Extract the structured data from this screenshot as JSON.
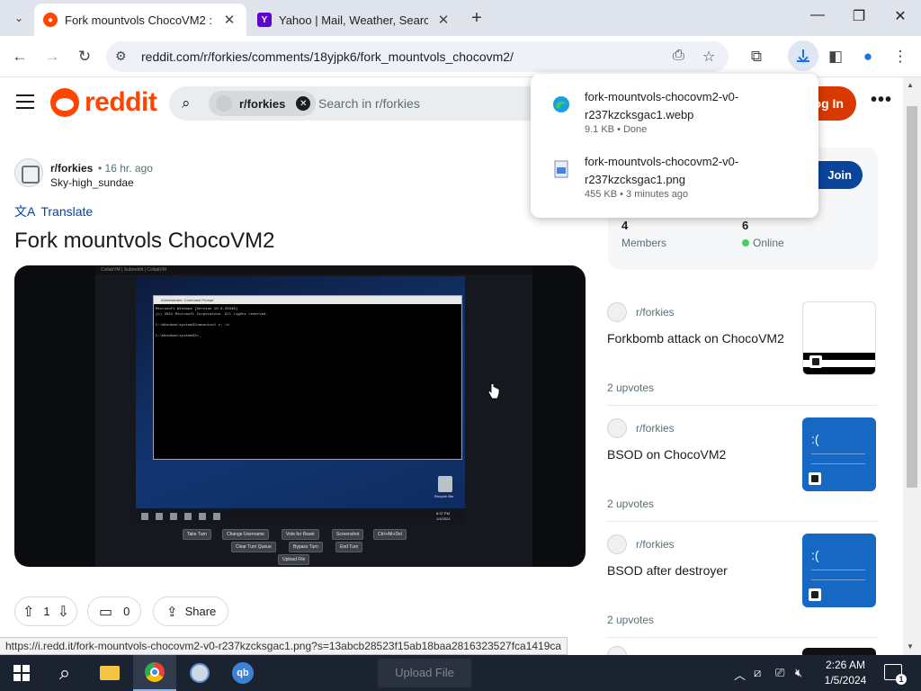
{
  "browser": {
    "tabs": [
      {
        "title": "Fork mountvols ChocoVM2 : r/",
        "active": true
      },
      {
        "title": "Yahoo | Mail, Weather, Search,",
        "active": false
      }
    ],
    "url": "reddit.com/r/forkies/comments/18yjpk6/fork_mountvols_chocovm2/",
    "status_url": "https://i.redd.it/fork-mountvols-chocovm2-v0-r237kzcksgac1.png?s=13abcb28523f15ab18baa2816323527fca1419ca"
  },
  "downloads": [
    {
      "name": "fork-mountvols-chocovm2-v0-r237kzcksgac1.webp",
      "meta": "9.1 KB • Done",
      "icon": "edge-icon"
    },
    {
      "name": "fork-mountvols-chocovm2-v0-r237kzcksgac1.png",
      "meta": "455 KB • 3 minutes ago",
      "icon": "image-file-icon"
    }
  ],
  "reddit": {
    "logo_text": "reddit",
    "search_chip": "r/forkies",
    "search_placeholder": "Search in r/forkies",
    "login_label": "Log In"
  },
  "post": {
    "subreddit": "r/forkies",
    "time": "• 16 hr. ago",
    "author": "Sky-high_sundae",
    "translate": "Translate",
    "title": "Fork mountvols ChocoVM2",
    "upvotes": "1",
    "comments": "0",
    "share_label": "Share"
  },
  "vm": {
    "top_bar": "CollabVM | Subreddit | CollabVM",
    "cmd_title": "Administrator: Command Prompt",
    "cmd_text": "Microsoft Windows [Version 10.0.20348]\n(c) 2021 Microsoft Corporation. All rights reserved.\n\nC:\\Windows\\system32>mountvol c: /d\n\nC:\\Windows\\system32>_",
    "recycle_label": "Recycle Bin",
    "clock": "8:37 PM\n1/4/2024",
    "buttons": [
      "Take Turn",
      "Change Username",
      "Vote for Reset",
      "Screenshot",
      "Ctrl+Alt+Del",
      "Clear Turn Queue",
      "Bypass Turn",
      "End Turn",
      "Upload File"
    ]
  },
  "sidebar": {
    "join_label": "Join",
    "members_count": "4",
    "members_label": "Members",
    "online_count": "6",
    "online_label": "Online",
    "related": [
      {
        "sub": "r/forkies",
        "title": "Forkbomb attack on ChocoVM2",
        "upvotes": "2 upvotes"
      },
      {
        "sub": "r/forkies",
        "title": "BSOD on ChocoVM2",
        "upvotes": "2 upvotes"
      },
      {
        "sub": "r/forkies",
        "title": "BSOD after destroyer",
        "upvotes": "2 upvotes"
      }
    ]
  },
  "taskbar": {
    "time": "2:26 AM",
    "date": "1/5/2024",
    "notifications": "1",
    "ghost_button": "Upload File"
  }
}
